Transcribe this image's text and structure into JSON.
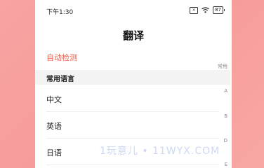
{
  "status_bar": {
    "time": "下午1:30",
    "battery": "87"
  },
  "header": {
    "title": "翻译"
  },
  "auto_detect": {
    "label": "自动检测"
  },
  "section": {
    "title": "常用语言"
  },
  "languages": [
    {
      "label": "中文"
    },
    {
      "label": "英语"
    },
    {
      "label": "日语"
    }
  ],
  "index_bar": [
    "常用",
    "A",
    "B",
    "D",
    "E"
  ],
  "watermark": "1玩意儿 • 11WYX.COM",
  "colors": {
    "accent": "#e8604c",
    "background": "#f79c98",
    "section_bg": "#f3f3f3"
  }
}
